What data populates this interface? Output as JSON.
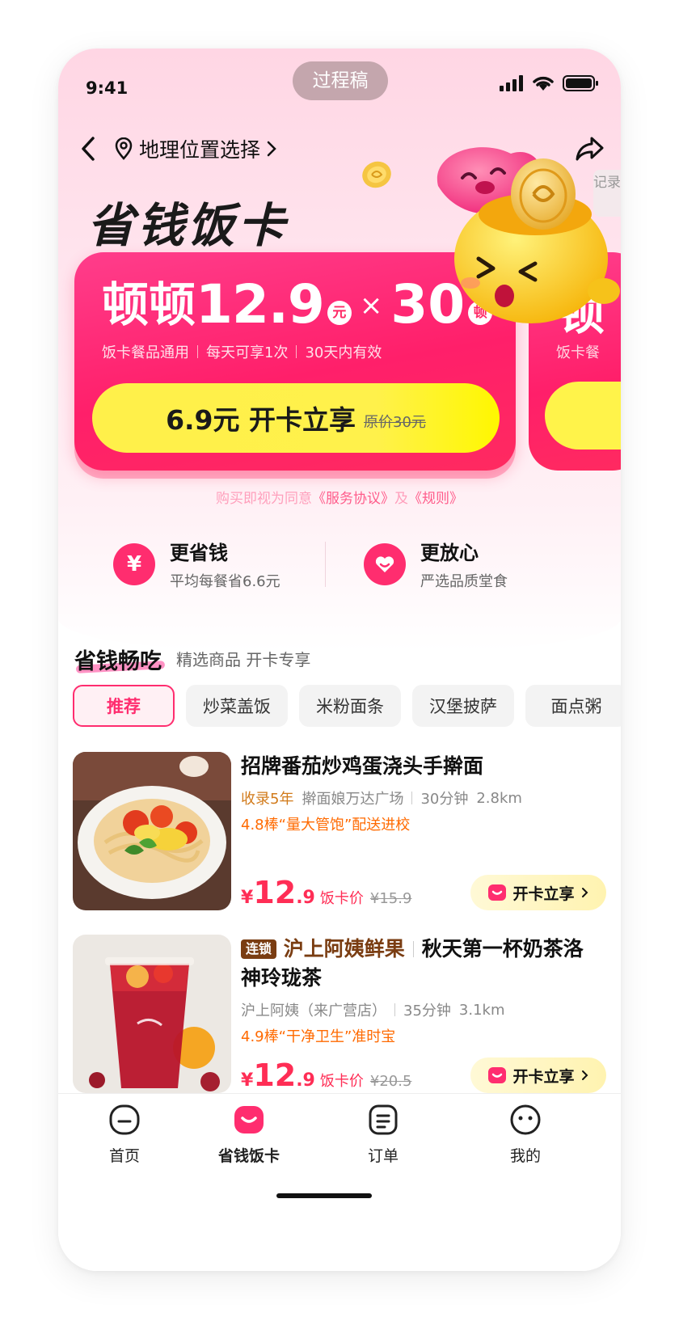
{
  "status_bar": {
    "time": "9:41",
    "draft_label": "过程稿"
  },
  "nav": {
    "location": "地理位置选择",
    "record_tab": "记录"
  },
  "page_title": "省钱饭卡",
  "promo_card": {
    "deal_word": "顿顿",
    "price": "12.9",
    "price_unit": "元",
    "times_symbol": "×",
    "quantity": "30",
    "quantity_unit": "顿",
    "features": [
      "饭卡餐品通用",
      "每天可享1次",
      "30天内有效"
    ],
    "cta_label": "6.9元 开卡立享",
    "original_price": "原价30元",
    "next_card_title": "顿",
    "next_card_sub": "饭卡餐"
  },
  "agreement": {
    "prefix": "购买即视为同意",
    "service": "《服务协议》",
    "and": "及",
    "rules": "《规则》"
  },
  "benefits": [
    {
      "icon": "yen-icon",
      "title": "更省钱",
      "subtitle": "平均每餐省6.6元"
    },
    {
      "icon": "heart-shield-icon",
      "title": "更放心",
      "subtitle": "严选品质堂食"
    }
  ],
  "section": {
    "title": "省钱畅吃",
    "subtitle": "精选商品 开卡专享"
  },
  "category_tabs": [
    "推荐",
    "炒菜盖饭",
    "米粉面条",
    "汉堡披萨",
    "面点粥"
  ],
  "products": [
    {
      "name": "招牌番茄炒鸡蛋浇头手擀面",
      "tag": "收录5年",
      "shop": "擀面娘万达广场",
      "time": "30分钟",
      "distance": "2.8km",
      "highlight": "4.8棒“量大管饱”配送进校",
      "price_yen": "¥",
      "price_int": "12",
      "price_dec": ".9",
      "price_label": "饭卡价",
      "orig_price": "¥15.9",
      "cta": "开卡立享"
    },
    {
      "chain_tag": "连锁",
      "brand": "沪上阿姨鲜果",
      "name": "秋天第一杯奶茶洛神玲珑茶",
      "shop": "沪上阿姨（来广营店）",
      "time": "35分钟",
      "distance": "3.1km",
      "highlight": "4.9棒“干净卫生”准时宝",
      "price_yen": "¥",
      "price_int": "12",
      "price_dec": ".9",
      "price_label": "饭卡价",
      "orig_price": "¥20.5",
      "cta": "开卡立享"
    }
  ],
  "tabbar": [
    {
      "label": "首页",
      "icon": "home-face-icon",
      "active": false
    },
    {
      "label": "省钱饭卡",
      "icon": "meal-card-icon",
      "active": true
    },
    {
      "label": "订单",
      "icon": "order-icon",
      "active": false
    },
    {
      "label": "我的",
      "icon": "profile-face-icon",
      "active": false
    }
  ],
  "colors": {
    "primary": "#ff2d6f",
    "cta_yellow": "#fff04a",
    "brand_brown": "#7a3d12",
    "highlight_orange": "#ff6a00"
  }
}
